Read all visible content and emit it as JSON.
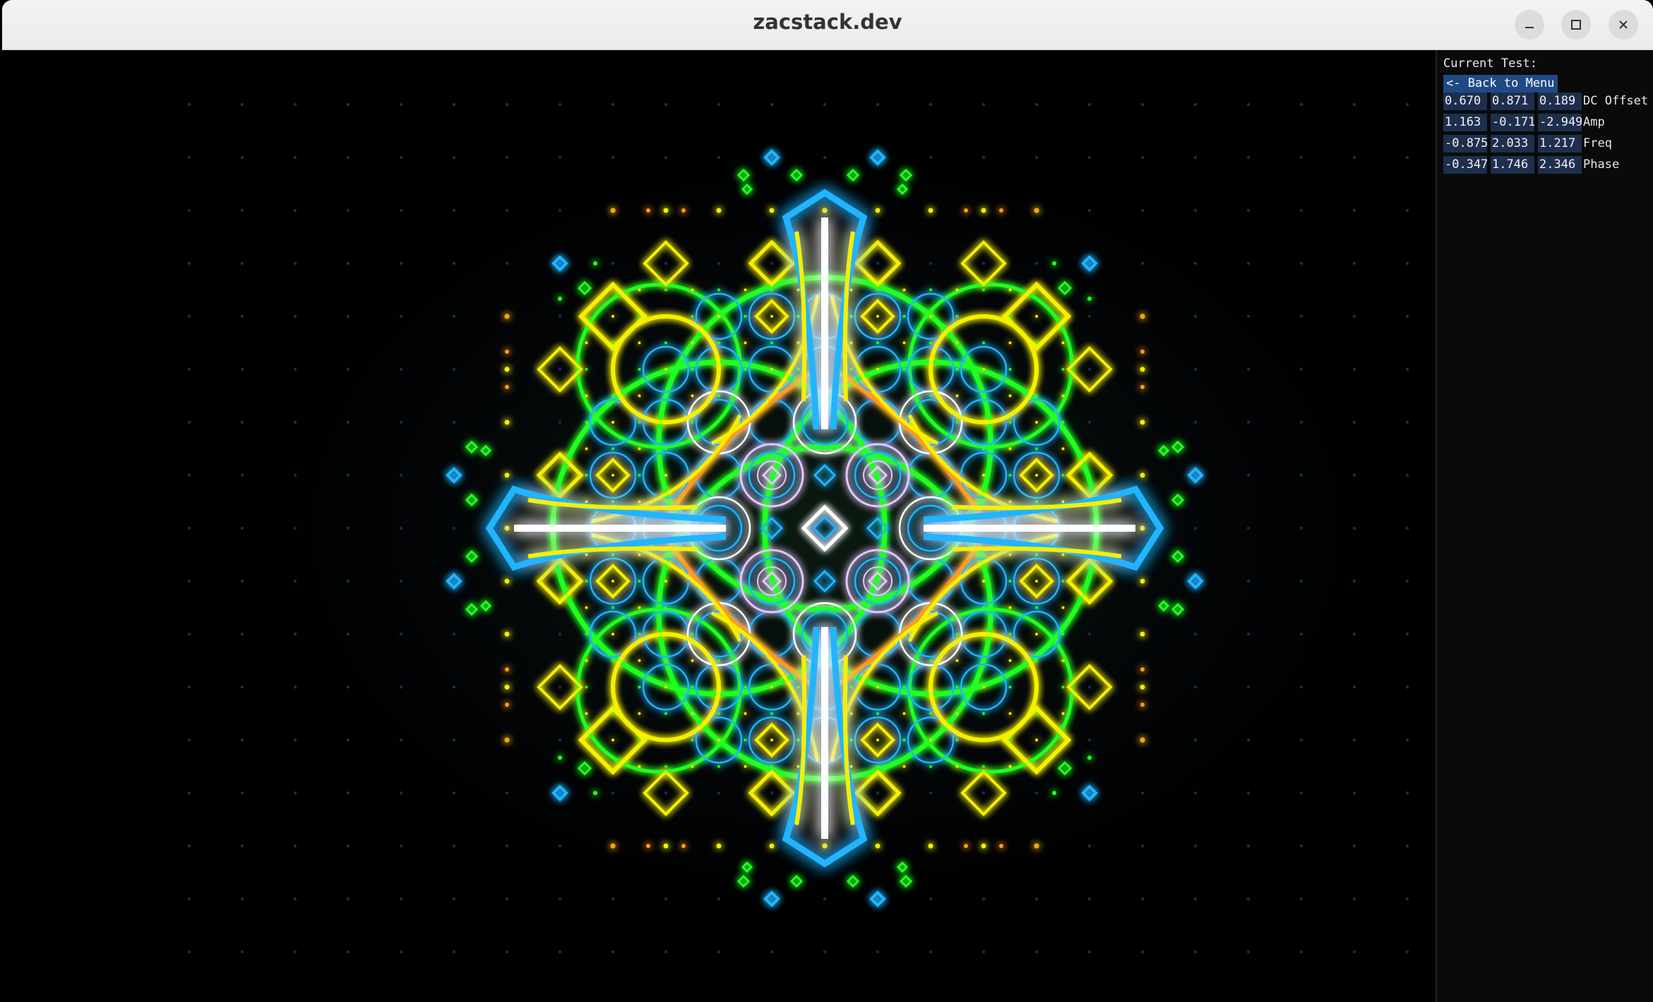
{
  "window": {
    "title": "zacstack.dev",
    "controls": {
      "minimize_icon": "minimize-icon",
      "maximize_icon": "maximize-icon",
      "close_icon": "close-icon"
    }
  },
  "panel": {
    "title": "Current Test:",
    "back_label": "<- Back to Menu",
    "params": [
      {
        "label": "DC Offset",
        "values": [
          "0.670",
          "0.871",
          "0.189"
        ]
      },
      {
        "label": "Amp",
        "values": [
          "1.163",
          "-0.171",
          "-2.949"
        ]
      },
      {
        "label": "Freq",
        "values": [
          "-0.875",
          "2.033",
          "1.217"
        ]
      },
      {
        "label": "Phase",
        "values": [
          "-0.347",
          "1.746",
          "2.346"
        ]
      }
    ]
  },
  "colors": {
    "background": "#000000",
    "cyan": "#22b4ff",
    "yellow": "#f5f000",
    "green": "#22ff22",
    "white": "#ffffff",
    "orange": "#ff9a1a",
    "violet": "#e2c8ff",
    "field": "#1d2f4d",
    "button": "#1f4a85"
  }
}
